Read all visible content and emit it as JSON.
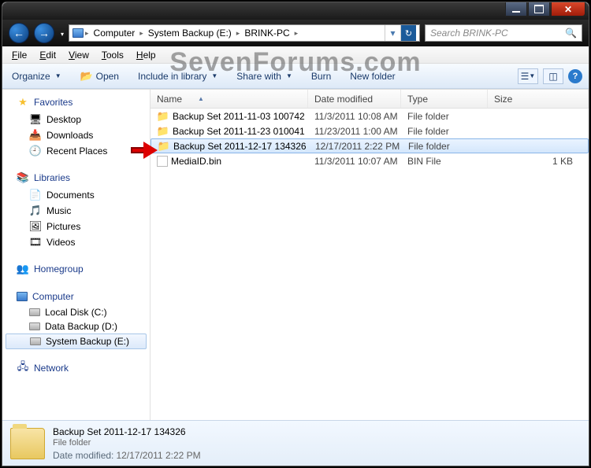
{
  "watermark": "SevenForums.com",
  "titlebar": {},
  "nav": {
    "breadcrumbs": [
      "Computer",
      "System Backup (E:)",
      "BRINK-PC"
    ],
    "search_placeholder": "Search BRINK-PC"
  },
  "menu": [
    "File",
    "Edit",
    "View",
    "Tools",
    "Help"
  ],
  "toolbar": {
    "organize": "Organize",
    "open": "Open",
    "include": "Include in library",
    "share": "Share with",
    "burn": "Burn",
    "newfolder": "New folder"
  },
  "sidebar": {
    "favorites": {
      "label": "Favorites",
      "items": [
        "Desktop",
        "Downloads",
        "Recent Places"
      ]
    },
    "libraries": {
      "label": "Libraries",
      "items": [
        "Documents",
        "Music",
        "Pictures",
        "Videos"
      ]
    },
    "homegroup": {
      "label": "Homegroup"
    },
    "computer": {
      "label": "Computer",
      "items": [
        "Local Disk (C:)",
        "Data Backup (D:)",
        "System Backup (E:)"
      ],
      "selected": 2
    },
    "network": {
      "label": "Network"
    }
  },
  "columns": {
    "name": "Name",
    "date": "Date modified",
    "type": "Type",
    "size": "Size"
  },
  "files": [
    {
      "icon": "folder",
      "name": "Backup Set 2011-11-03 100742",
      "date": "11/3/2011 10:08 AM",
      "type": "File folder",
      "size": "",
      "sel": false
    },
    {
      "icon": "folder",
      "name": "Backup Set 2011-11-23 010041",
      "date": "11/23/2011 1:00 AM",
      "type": "File folder",
      "size": "",
      "sel": false
    },
    {
      "icon": "folder",
      "name": "Backup Set 2011-12-17 134326",
      "date": "12/17/2011 2:22 PM",
      "type": "File folder",
      "size": "",
      "sel": true
    },
    {
      "icon": "file",
      "name": "MediaID.bin",
      "date": "11/3/2011 10:07 AM",
      "type": "BIN File",
      "size": "1 KB",
      "sel": false
    }
  ],
  "details": {
    "name": "Backup Set 2011-12-17 134326",
    "type": "File folder",
    "mod_label": "Date modified:",
    "mod_value": "12/17/2011 2:22 PM"
  }
}
